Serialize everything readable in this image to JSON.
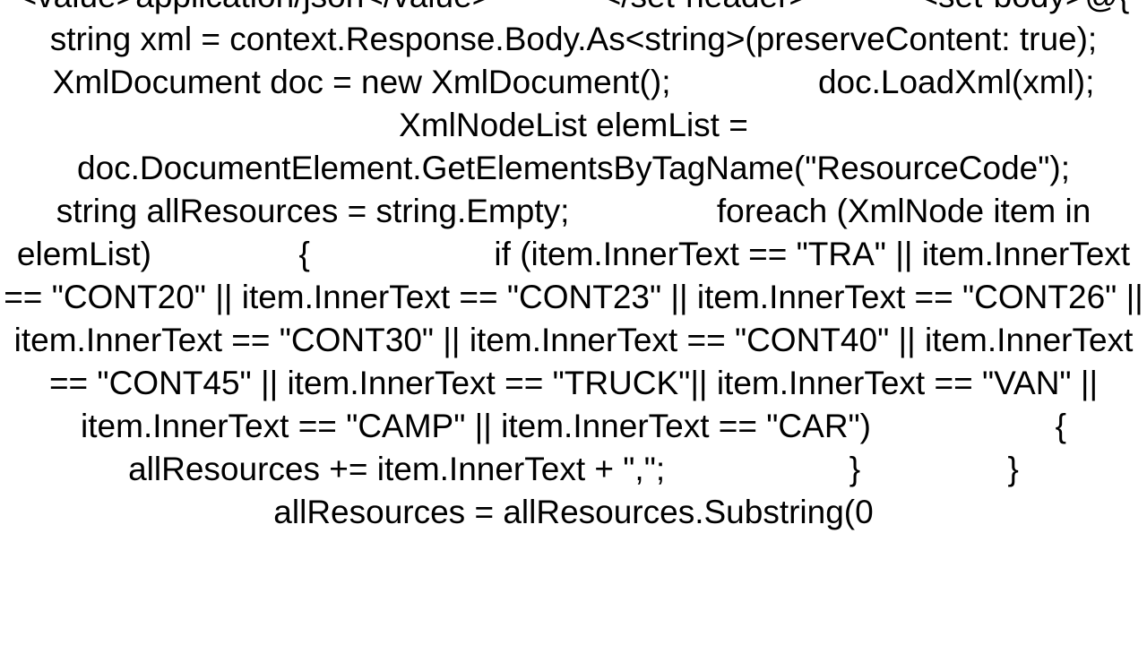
{
  "code": {
    "text": "<value>application/json</value>            </set-header>            <set-body>@{                string xml = context.Response.Body.As<string>(preserveContent: true);                XmlDocument doc = new XmlDocument();                doc.LoadXml(xml);                XmlNodeList elemList = doc.DocumentElement.GetElementsByTagName(\"ResourceCode\");                string allResources = string.Empty;                foreach (XmlNode item in elemList)                {                    if (item.InnerText == \"TRA\" || item.InnerText == \"CONT20\" || item.InnerText == \"CONT23\" || item.InnerText == \"CONT26\" || item.InnerText == \"CONT30\" || item.InnerText == \"CONT40\" || item.InnerText == \"CONT45\" || item.InnerText == \"TRUCK\"|| item.InnerText == \"VAN\" || item.InnerText == \"CAMP\" || item.InnerText == \"CAR\")                    {                        allResources += item.InnerText + \",\";                    }                }                allResources = allResources.Substring(0"
  }
}
